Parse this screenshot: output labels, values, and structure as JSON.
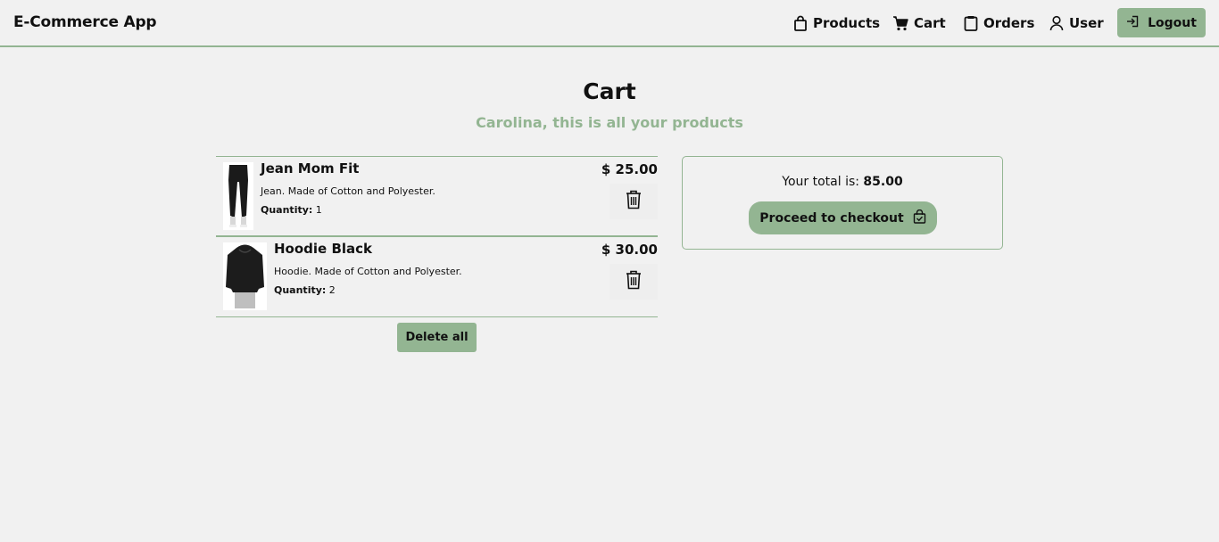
{
  "header": {
    "brand": "E-Commerce App",
    "nav": [
      {
        "label": "Products",
        "icon": "bag-icon"
      },
      {
        "label": "Cart",
        "icon": "cart-icon"
      },
      {
        "label": "Orders",
        "icon": "clipboard-icon"
      },
      {
        "label": "User",
        "icon": "user-icon"
      }
    ],
    "logout_label": "Logout"
  },
  "main": {
    "title": "Cart",
    "subtitle": "Carolina, this is all your products"
  },
  "cart": {
    "items": [
      {
        "name": "Jean Mom Fit",
        "description": "Jean. Made of Cotton and Polyester.",
        "quantity_label": "Quantity:",
        "quantity": "1",
        "price": "$ 25.00",
        "image": "black-jeans-image"
      },
      {
        "name": "Hoodie Black",
        "description": "Hoodie. Made of Cotton and Polyester.",
        "quantity_label": "Quantity:",
        "quantity": "2",
        "price": "$ 30.00",
        "image": "black-hoodie-image"
      }
    ],
    "delete_all_label": "Delete all"
  },
  "summary": {
    "total_label": "Your total is:",
    "total_value": "85.00",
    "checkout_label": "Proceed to checkout"
  },
  "colors": {
    "accent": "#93b592",
    "background": "#f1f1f1",
    "text": "#111111"
  }
}
